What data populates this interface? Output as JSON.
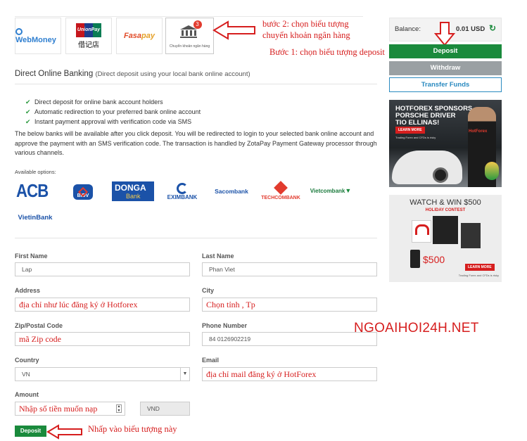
{
  "methods": {
    "webmoney": "WebMoney",
    "unionpay_brand": "UnionPay",
    "unionpay_cn": "银联",
    "unionpay_sub": "借记店",
    "fasapay_a": "Fasa",
    "fasapay_b": "pay",
    "bank_transfer_caption": "Chuyển khoản ngân hàng",
    "bank_transfer_badge": "3"
  },
  "annotations": {
    "step2_line1": "bước 2: chọn biểu tượng",
    "step2_line2": "chuyển khoản ngân hàng",
    "step1": "Bước 1: chọn biểu tượng deposit",
    "click_icon": "Nhấp vào biểu tượng này",
    "watermark": "NGOAIHOI24H.NET"
  },
  "section": {
    "title": "Direct Online Banking",
    "subtitle": "(Direct deposit using your local bank online account)",
    "features": [
      "Direct deposit for online bank account holders",
      "Automatic redirection to your preferred bank online account",
      "Instant payment approval with verification code via SMS"
    ],
    "description": "The below banks will be available after you click deposit. You will be redirected to login to your selected bank online account and approve the payment with an SMS verification code. The transaction is handled by ZotaPay Payment Gateway processor through various channels.",
    "available_label": "Available options:"
  },
  "banks": {
    "acb": "ACB",
    "bidv": "BIDV",
    "donga_a": "DONGA",
    "donga_b": "Bank",
    "eximbank": "EXIMBANK",
    "sacombank": "Sacombank",
    "techcombank": "TECHCOMBANK",
    "vietcombank": "Vietcombank",
    "vietinbank": "VietinBank"
  },
  "form": {
    "first_name_label": "First Name",
    "first_name_value": "Lap",
    "last_name_label": "Last Name",
    "last_name_value": "Phan Viet",
    "address_label": "Address",
    "address_value": "địa chỉ như lúc đăng ký ở Hotforex",
    "city_label": "City",
    "city_value": "Chọn tỉnh , Tp",
    "zip_label": "Zip/Postal Code",
    "zip_value": "mã Zip code",
    "phone_label": "Phone Number",
    "phone_value": "84 0126902219",
    "country_label": "Country",
    "country_value": "VN",
    "email_label": "Email",
    "email_value": "địa chỉ mail đăng ký ở HotForex",
    "amount_label": "Amount",
    "amount_value": "Nhập số tiền muốn nạp",
    "currency": "VND",
    "deposit_button": "Deposit"
  },
  "account": {
    "balance_label": "Balance:",
    "balance_value": "0.01 USD",
    "deposit": "Deposit",
    "withdraw": "Withdraw",
    "transfer": "Transfer Funds"
  },
  "banner1": {
    "line1": "HOTFOREX SPONSORS",
    "line2": "PORSCHE DRIVER",
    "line3": "TIO ELLINAS!",
    "button": "LEARN MORE",
    "disclaimer": "Trading Forex and CFDs is risky",
    "brand": "HotForex"
  },
  "banner2": {
    "line1": "WATCH & WIN $500",
    "line2": "HOLIDAY CONTEST",
    "amount": "$500",
    "button": "LEARN MORE",
    "disclaimer": "Trading Forex and CFDs is risky"
  },
  "colors": {
    "accent_green": "#1a8a3c",
    "annotation_red": "#d61e1e",
    "gray_button": "#9aa0a3"
  }
}
